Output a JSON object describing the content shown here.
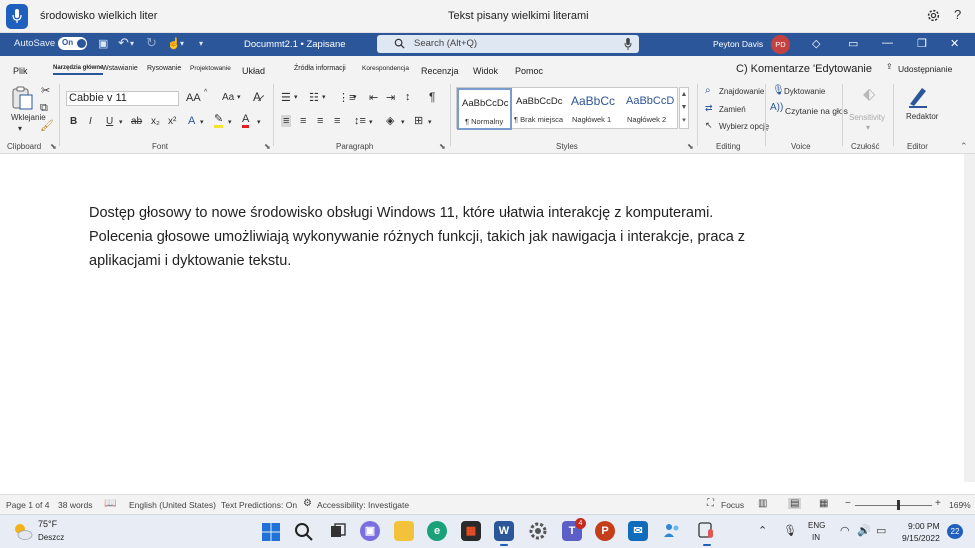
{
  "voice_access": {
    "last_command": "środowisko wielkich liter",
    "status": "Tekst pisany wielkimi literami",
    "help": "?"
  },
  "titlebar": {
    "autosave_label": "AutoSave",
    "autosave_state": "On",
    "document": "Docummt2.1 • Zapisane",
    "search_placeholder": "Search (Alt+Q)",
    "user_name": "Peyton Davis",
    "user_initials": "PD"
  },
  "tabs": {
    "items": [
      "Plik",
      "Narzędzia główne",
      "Wstawianie",
      "Rysowanie",
      "Projektowanie",
      "Układ",
      "Źródła informacji",
      "Korespondencja",
      "Recenzja",
      "Widok",
      "Pomoc"
    ],
    "comments": "C) Komentarze 'Edytowanie",
    "share": "Udostępnianie"
  },
  "ribbon": {
    "clipboard": {
      "paste": "Wklejanie",
      "label": "Clipboard"
    },
    "font": {
      "name": "Cabbie v 11",
      "grow": "AA",
      "case": "Aa",
      "bold": "B",
      "italic": "I",
      "underline": "U",
      "strike": "ab",
      "subscript": "x₂",
      "superscript": "x²",
      "effects": "A",
      "color": "A",
      "label": "Font"
    },
    "paragraph": {
      "marks": "¶",
      "label": "Paragraph"
    },
    "styles": {
      "items": [
        {
          "sample": "AaBbCcDc",
          "name": "¶ Normalny"
        },
        {
          "sample": "AaBbCcDc",
          "name": "¶ Brak miejsca"
        },
        {
          "sample": "AaBbCc",
          "name": "Nagłówek 1"
        },
        {
          "sample": "AaBbCcD",
          "name": "Nagłówek 2"
        }
      ],
      "label": "Styles"
    },
    "editing": {
      "find": "Znajdowanie",
      "replace": "Zamień",
      "select": "Wybierz opcję",
      "label": "Editing"
    },
    "voice": {
      "dictate": "Dyktowanie",
      "read_aloud": "Czytanie na głos",
      "label": "Voice"
    },
    "sensitivity": {
      "button": "Sensitivity",
      "label": "Czułość"
    },
    "editor": {
      "button": "Redaktor",
      "label": "Editor"
    }
  },
  "document": {
    "text": "Dostęp głosowy to nowe środowisko obsługi Windows 11, które ułatwia interakcję z komputerami. Polecenia głosowe umożliwiają wykonywanie różnych funkcji, takich jak nawigacja i interakcje, praca z aplikacjami i dyktowanie tekstu."
  },
  "statusbar": {
    "page": "Page 1 of 4",
    "words": "38 words",
    "language": "English (United States)",
    "predictions": "Text Predictions: On",
    "accessibility": "Accessibility: Investigate",
    "focus": "Focus",
    "zoom": "169%",
    "zoom_minus": "−",
    "zoom_plus": "+"
  },
  "taskbar": {
    "weather_temp": "75°F",
    "weather_cond": "Deszcz",
    "teams_badge": "4",
    "lang_line1": "ENG",
    "lang_line2": "IN",
    "time": "9:00 PM",
    "date": "9/15/2022",
    "notifications": "22"
  },
  "colors": {
    "word_blue": "#2b579a",
    "voice_blue": "#1f5fbd",
    "avatar": "#c3413f"
  }
}
